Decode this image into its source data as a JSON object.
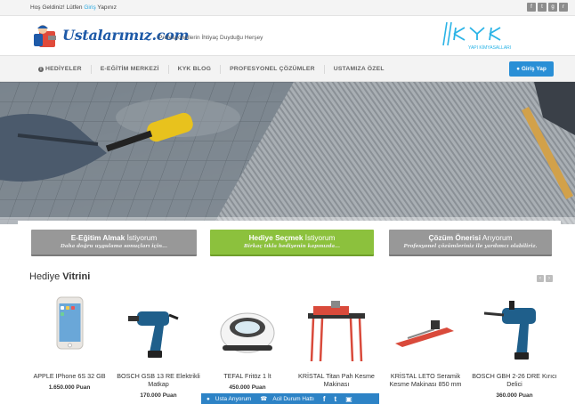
{
  "topbar": {
    "welcome_before": "Hoş Geldiniz! Lütfen ",
    "welcome_link": "Giriş",
    "welcome_after": " Yapınız"
  },
  "header": {
    "logo_text": "Ustalarımız.com",
    "tagline": "Profesyonellerin İhtiyaç Duyduğu Herşey",
    "partner_logo_text": "YAPI KİMYASALLARI"
  },
  "nav": {
    "items": [
      "HEDİYELER",
      "E-EĞİTİM MERKEZİ",
      "KYK BLOG",
      "PROFESYONEL ÇÖZÜMLER",
      "USTAMIZA ÖZEL"
    ],
    "login_label": "Giriş Yap"
  },
  "cta": [
    {
      "strong": "E-Eğitim Almak",
      "rest": " İstiyorum",
      "sub": "Daha doğru uygulama sonuçları için..."
    },
    {
      "strong": "Hediye Seçmek",
      "rest": " İstiyorum",
      "sub": "Birkaç tıkla hediyenin kapınızda..."
    },
    {
      "strong": "Çözüm Önerisi",
      "rest": " Arıyorum",
      "sub": "Profesyonel çözümleriniz ile yardımcı olabiliriz."
    }
  ],
  "showcase": {
    "title_plain": "Hediye ",
    "title_bold": "Vitrini"
  },
  "products": [
    {
      "name": "APPLE IPhone 6S 32 GB",
      "price": "1.650.000 Puan"
    },
    {
      "name": "BOSCH GSB 13 RE Elektrikli Matkap",
      "price": "170.000 Puan"
    },
    {
      "name": "TEFAL Fritöz 1 lt",
      "price": "450.000 Puan"
    },
    {
      "name": "KRİSTAL Titan Pah Kesme Makinası",
      "price": ""
    },
    {
      "name": "KRİSTAL LETO Seramik Kesme Makinası 850 mm",
      "price": ""
    },
    {
      "name": "BOSCH GBH 2-26 DRE Kırıcı Delici",
      "price": "360.000 Puan"
    }
  ],
  "bottombar": {
    "usta": "Usta Arıyorum",
    "hotline": "Acil Durum Hattı"
  },
  "icons": [
    "facebook-icon",
    "twitter-icon",
    "google-plus-icon",
    "rss-icon",
    "info-icon",
    "user-icon",
    "phone-icon",
    "instagram-icon"
  ],
  "colors": {
    "accent_blue": "#2a8fd6",
    "cta_green": "#8cc13d",
    "cta_grey": "#989898",
    "link_blue": "#27a9e1"
  }
}
